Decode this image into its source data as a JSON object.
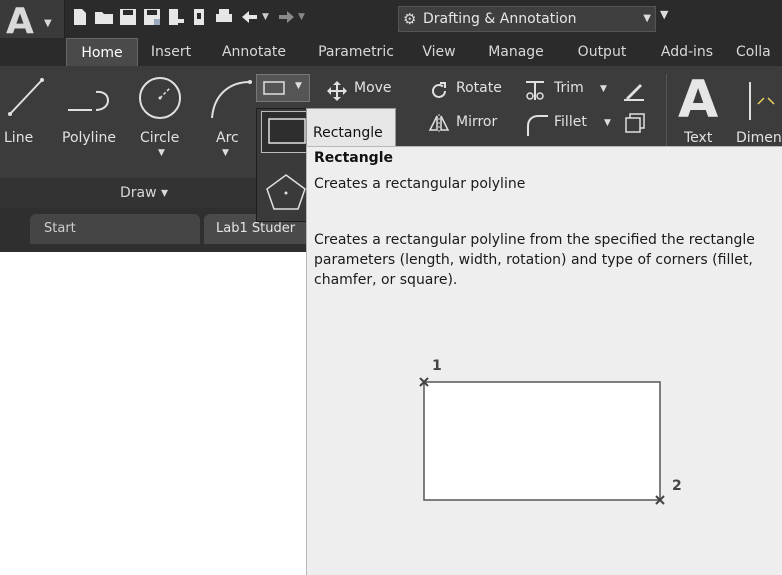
{
  "quick_access": {
    "workspace_label": "Drafting & Annotation"
  },
  "ribbon_tabs": [
    {
      "label": "Home",
      "active": true
    },
    {
      "label": "Insert"
    },
    {
      "label": "Annotate"
    },
    {
      "label": "Parametric"
    },
    {
      "label": "View"
    },
    {
      "label": "Manage"
    },
    {
      "label": "Output"
    },
    {
      "label": "Add-ins"
    },
    {
      "label": "Colla"
    }
  ],
  "draw_panel": {
    "buttons": {
      "line": "Line",
      "polyline": "Polyline",
      "circle": "Circle",
      "arc": "Arc"
    },
    "panel_label": "Draw ▾"
  },
  "modify_panel": {
    "move": "Move",
    "rotate": "Rotate",
    "trim": "Trim",
    "mirror": "Mirror",
    "fillet": "Fillet"
  },
  "annotation_panel": {
    "text": "Text",
    "dimension": "Dimen"
  },
  "flyout": {
    "rectangle": "Rectangle"
  },
  "document_tabs": [
    {
      "label": "Start"
    },
    {
      "label": "Lab1 Studer"
    }
  ],
  "tooltip": {
    "title": "Rectangle",
    "short": "Creates a rectangular polyline",
    "long": "Creates a rectangular polyline from the specified the rectangle parameters (length, width, rotation) and type of corners (fillet, chamfer, or square).",
    "diagram": {
      "point1_label": "1",
      "point2_label": "2"
    }
  },
  "colors": {
    "ribbon_bg": "#3c3c3c",
    "titlebar_bg": "#2b2b2b",
    "tooltip_bg": "#eeeeee",
    "icon_color": "#e0e0e0"
  }
}
